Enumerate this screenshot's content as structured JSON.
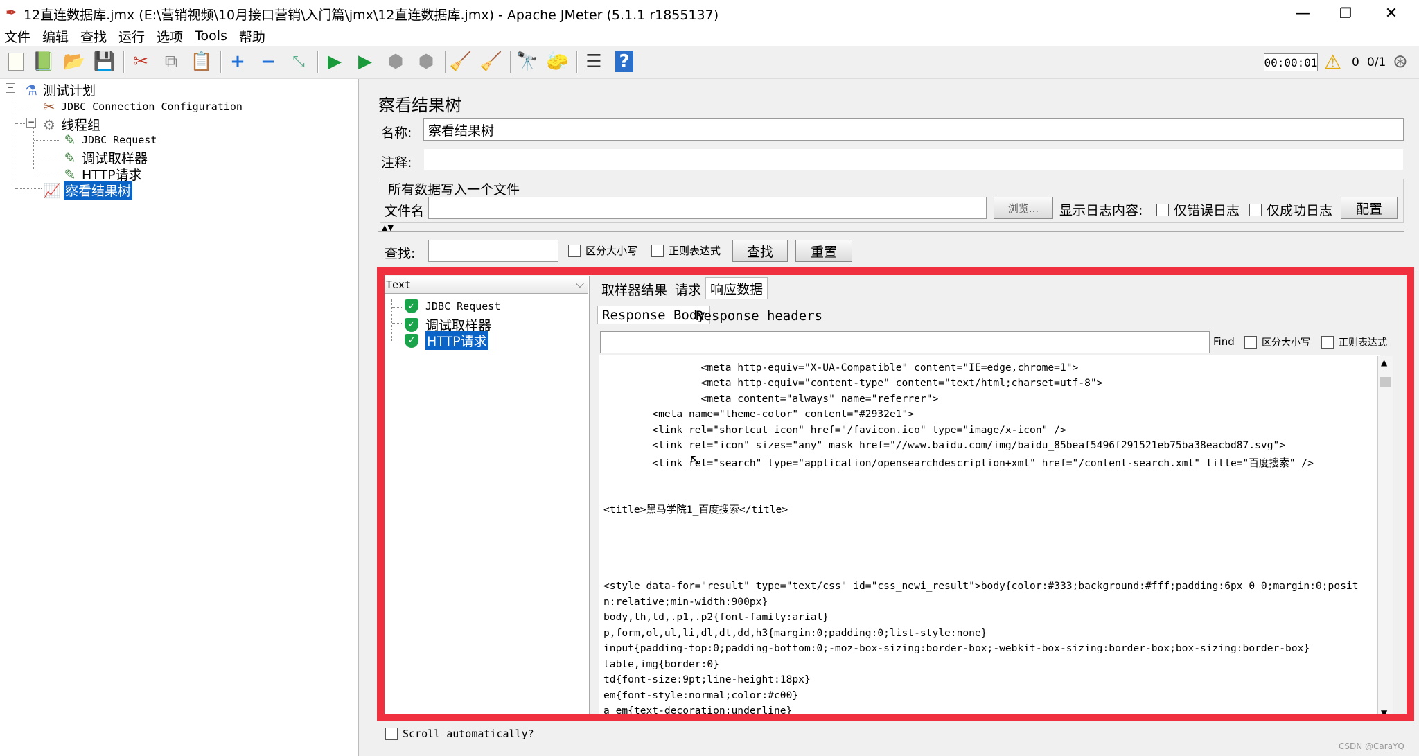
{
  "window": {
    "title": "12直连数据库.jmx (E:\\营销视频\\10月接口营销\\入门篇\\jmx\\12直连数据库.jmx) - Apache JMeter (5.1.1 r1855137)",
    "minimize": "—",
    "maximize": "❐",
    "close": "✕"
  },
  "menu": [
    "文件",
    "编辑",
    "查找",
    "运行",
    "选项",
    "Tools",
    "帮助"
  ],
  "toolbar": {
    "timer": "00:00:01",
    "warn_count": "0",
    "threads": "0/1"
  },
  "tree": {
    "items": [
      {
        "label": "测试计划",
        "icon": "test-plan-icon"
      },
      {
        "label": "JDBC Connection Configuration",
        "icon": "config-icon"
      },
      {
        "label": "线程组",
        "icon": "gear-icon"
      },
      {
        "label": "JDBC Request",
        "icon": "sampler-icon"
      },
      {
        "label": "调试取样器",
        "icon": "sampler-icon"
      },
      {
        "label": "HTTP请求",
        "icon": "sampler-icon"
      },
      {
        "label": "察看结果树",
        "icon": "listener-icon"
      }
    ]
  },
  "panel": {
    "title": "察看结果树",
    "name_label": "名称:",
    "name_value": "察看结果树",
    "comment_label": "注释:",
    "file_section": "所有数据写入一个文件",
    "filename_label": "文件名",
    "browse": "浏览...",
    "log_label": "显示日志内容:",
    "errors_only": "仅错误日志",
    "success_only": "仅成功日志",
    "configure": "配置",
    "search_label": "查找:",
    "case_sensitive": "区分大小写",
    "regex": "正则表达式",
    "search_btn": "查找",
    "reset_btn": "重置"
  },
  "results": {
    "renderer": "Text",
    "items": [
      "JDBC Request",
      "调试取样器",
      "HTTP请求"
    ],
    "scroll_auto": "Scroll automatically?"
  },
  "tabs": [
    "取样器结果",
    "请求",
    "响应数据"
  ],
  "subtabs": [
    "Response Body",
    "Response headers"
  ],
  "find": {
    "label": "Find",
    "case": "区分大小写",
    "regex": "正则表达式"
  },
  "code": [
    "                <meta http-equiv=\"X-UA-Compatible\" content=\"IE=edge,chrome=1\">",
    "                <meta http-equiv=\"content-type\" content=\"text/html;charset=utf-8\">",
    "                <meta content=\"always\" name=\"referrer\">",
    "        <meta name=\"theme-color\" content=\"#2932e1\">",
    "        <link rel=\"shortcut icon\" href=\"/favicon.ico\" type=\"image/x-icon\" />",
    "        <link rel=\"icon\" sizes=\"any\" mask href=\"//www.baidu.com/img/baidu_85beaf5496f291521eb75ba38eacbd87.svg\">",
    "        <link rel=\"search\" type=\"application/opensearchdescription+xml\" href=\"/content-search.xml\" title=\"百度搜索\" />",
    "",
    "",
    "<title>黑马学院1_百度搜索</title>",
    "",
    "",
    "",
    "",
    "",
    "<style data-for=\"result\" type=\"text/css\" id=\"css_newi_result\">body{color:#333;background:#fff;padding:6px 0 0;margin:0;posit",
    "n:relative;min-width:900px}",
    "body,th,td,.p1,.p2{font-family:arial}",
    "p,form,ol,ul,li,dl,dt,dd,h3{margin:0;padding:0;list-style:none}",
    "input{padding-top:0;padding-bottom:0;-moz-box-sizing:border-box;-webkit-box-sizing:border-box;box-sizing:border-box}",
    "table,img{border:0}",
    "td{font-size:9pt;line-height:18px}",
    "em{font-style:normal;color:#c00}",
    "a em{text-decoration:underline}"
  ],
  "watermark": "CSDN @CaraYQ"
}
